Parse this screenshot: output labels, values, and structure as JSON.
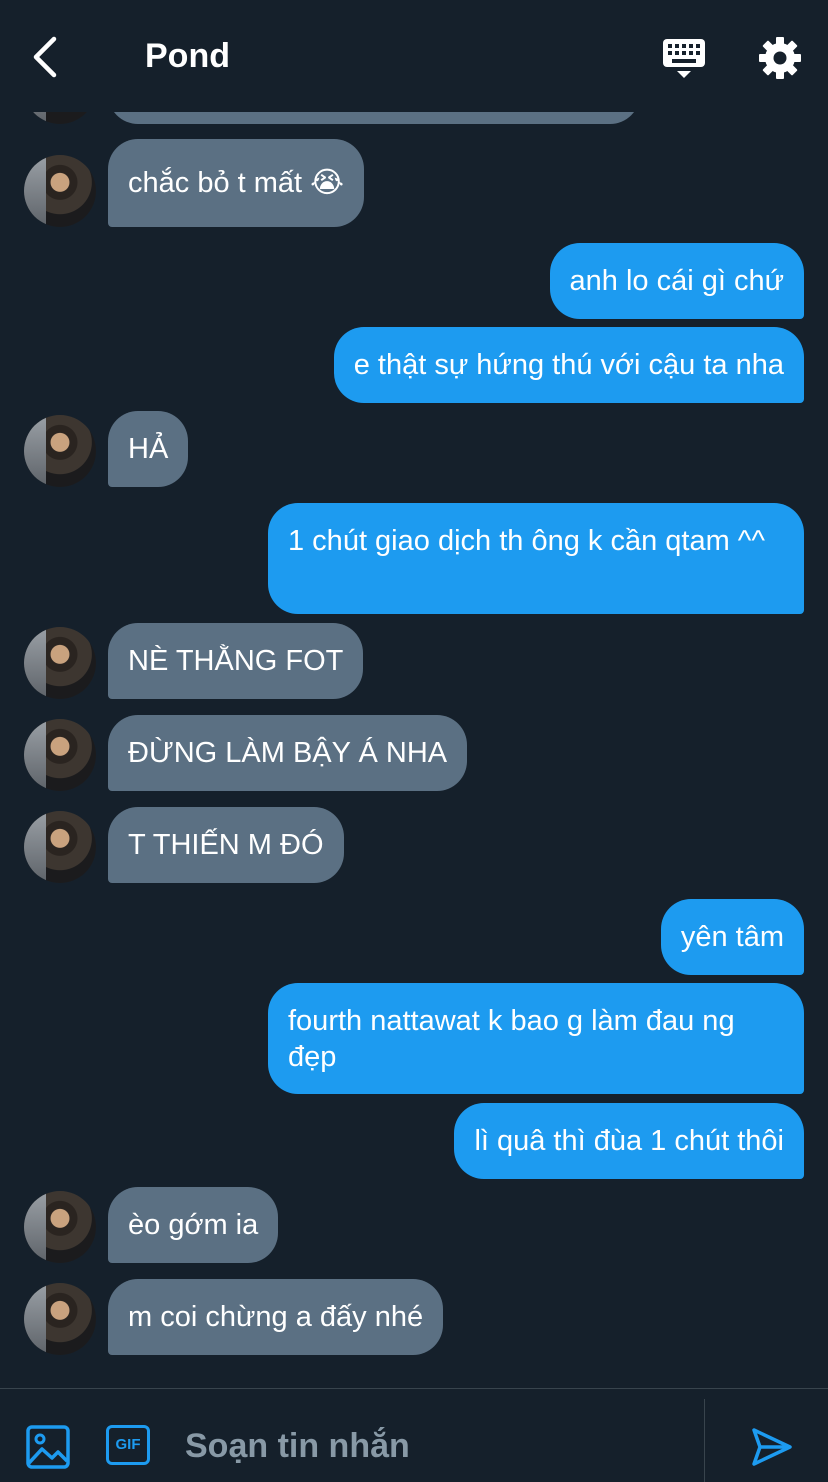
{
  "header": {
    "title": "Pond",
    "back_icon": "chevron-left-icon",
    "keyboard_icon": "keyboard-icon",
    "settings_icon": "gear-icon"
  },
  "messages": [
    {
      "from": "them",
      "text": "chắc bỏ t mất 😭"
    },
    {
      "from": "me",
      "text": "anh lo cái gì chứ"
    },
    {
      "from": "me",
      "text": "e thật sự hứng thú với cậu ta nha"
    },
    {
      "from": "them",
      "text": "HẢ"
    },
    {
      "from": "me",
      "text": "1 chút giao dịch th ông k cần qtam ^^"
    },
    {
      "from": "them",
      "text": "NÈ THẰNG FOT"
    },
    {
      "from": "them",
      "text": "ĐỪNG LÀM BẬY Á NHA"
    },
    {
      "from": "them",
      "text": "T THIẾN M ĐÓ"
    },
    {
      "from": "me",
      "text": "yên tâm"
    },
    {
      "from": "me",
      "text": "fourth nattawat k bao g làm đau ng đẹp"
    },
    {
      "from": "me",
      "text": "lì quâ thì đùa 1 chút thôi"
    },
    {
      "from": "them",
      "text": "èo gớm ia"
    },
    {
      "from": "them",
      "text": "m coi chừng a đấy nhé"
    }
  ],
  "composer": {
    "placeholder": "Soạn tin nhắn",
    "gif_label": "GIF",
    "image_icon": "image-icon",
    "send_icon": "send-icon"
  },
  "colors": {
    "background": "#15202b",
    "incoming_bubble": "#5b7083",
    "outgoing_bubble": "#1d9bf0",
    "accent": "#1d9bf0"
  }
}
